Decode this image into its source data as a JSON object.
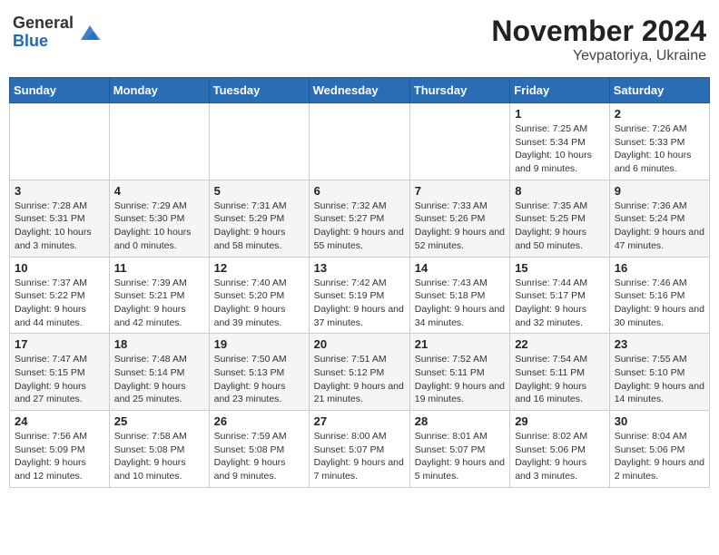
{
  "header": {
    "logo_general": "General",
    "logo_blue": "Blue",
    "title": "November 2024",
    "location": "Yevpatoriya, Ukraine"
  },
  "weekdays": [
    "Sunday",
    "Monday",
    "Tuesday",
    "Wednesday",
    "Thursday",
    "Friday",
    "Saturday"
  ],
  "weeks": [
    [
      {
        "day": "",
        "info": ""
      },
      {
        "day": "",
        "info": ""
      },
      {
        "day": "",
        "info": ""
      },
      {
        "day": "",
        "info": ""
      },
      {
        "day": "",
        "info": ""
      },
      {
        "day": "1",
        "info": "Sunrise: 7:25 AM\nSunset: 5:34 PM\nDaylight: 10 hours and 9 minutes."
      },
      {
        "day": "2",
        "info": "Sunrise: 7:26 AM\nSunset: 5:33 PM\nDaylight: 10 hours and 6 minutes."
      }
    ],
    [
      {
        "day": "3",
        "info": "Sunrise: 7:28 AM\nSunset: 5:31 PM\nDaylight: 10 hours and 3 minutes."
      },
      {
        "day": "4",
        "info": "Sunrise: 7:29 AM\nSunset: 5:30 PM\nDaylight: 10 hours and 0 minutes."
      },
      {
        "day": "5",
        "info": "Sunrise: 7:31 AM\nSunset: 5:29 PM\nDaylight: 9 hours and 58 minutes."
      },
      {
        "day": "6",
        "info": "Sunrise: 7:32 AM\nSunset: 5:27 PM\nDaylight: 9 hours and 55 minutes."
      },
      {
        "day": "7",
        "info": "Sunrise: 7:33 AM\nSunset: 5:26 PM\nDaylight: 9 hours and 52 minutes."
      },
      {
        "day": "8",
        "info": "Sunrise: 7:35 AM\nSunset: 5:25 PM\nDaylight: 9 hours and 50 minutes."
      },
      {
        "day": "9",
        "info": "Sunrise: 7:36 AM\nSunset: 5:24 PM\nDaylight: 9 hours and 47 minutes."
      }
    ],
    [
      {
        "day": "10",
        "info": "Sunrise: 7:37 AM\nSunset: 5:22 PM\nDaylight: 9 hours and 44 minutes."
      },
      {
        "day": "11",
        "info": "Sunrise: 7:39 AM\nSunset: 5:21 PM\nDaylight: 9 hours and 42 minutes."
      },
      {
        "day": "12",
        "info": "Sunrise: 7:40 AM\nSunset: 5:20 PM\nDaylight: 9 hours and 39 minutes."
      },
      {
        "day": "13",
        "info": "Sunrise: 7:42 AM\nSunset: 5:19 PM\nDaylight: 9 hours and 37 minutes."
      },
      {
        "day": "14",
        "info": "Sunrise: 7:43 AM\nSunset: 5:18 PM\nDaylight: 9 hours and 34 minutes."
      },
      {
        "day": "15",
        "info": "Sunrise: 7:44 AM\nSunset: 5:17 PM\nDaylight: 9 hours and 32 minutes."
      },
      {
        "day": "16",
        "info": "Sunrise: 7:46 AM\nSunset: 5:16 PM\nDaylight: 9 hours and 30 minutes."
      }
    ],
    [
      {
        "day": "17",
        "info": "Sunrise: 7:47 AM\nSunset: 5:15 PM\nDaylight: 9 hours and 27 minutes."
      },
      {
        "day": "18",
        "info": "Sunrise: 7:48 AM\nSunset: 5:14 PM\nDaylight: 9 hours and 25 minutes."
      },
      {
        "day": "19",
        "info": "Sunrise: 7:50 AM\nSunset: 5:13 PM\nDaylight: 9 hours and 23 minutes."
      },
      {
        "day": "20",
        "info": "Sunrise: 7:51 AM\nSunset: 5:12 PM\nDaylight: 9 hours and 21 minutes."
      },
      {
        "day": "21",
        "info": "Sunrise: 7:52 AM\nSunset: 5:11 PM\nDaylight: 9 hours and 19 minutes."
      },
      {
        "day": "22",
        "info": "Sunrise: 7:54 AM\nSunset: 5:11 PM\nDaylight: 9 hours and 16 minutes."
      },
      {
        "day": "23",
        "info": "Sunrise: 7:55 AM\nSunset: 5:10 PM\nDaylight: 9 hours and 14 minutes."
      }
    ],
    [
      {
        "day": "24",
        "info": "Sunrise: 7:56 AM\nSunset: 5:09 PM\nDaylight: 9 hours and 12 minutes."
      },
      {
        "day": "25",
        "info": "Sunrise: 7:58 AM\nSunset: 5:08 PM\nDaylight: 9 hours and 10 minutes."
      },
      {
        "day": "26",
        "info": "Sunrise: 7:59 AM\nSunset: 5:08 PM\nDaylight: 9 hours and 9 minutes."
      },
      {
        "day": "27",
        "info": "Sunrise: 8:00 AM\nSunset: 5:07 PM\nDaylight: 9 hours and 7 minutes."
      },
      {
        "day": "28",
        "info": "Sunrise: 8:01 AM\nSunset: 5:07 PM\nDaylight: 9 hours and 5 minutes."
      },
      {
        "day": "29",
        "info": "Sunrise: 8:02 AM\nSunset: 5:06 PM\nDaylight: 9 hours and 3 minutes."
      },
      {
        "day": "30",
        "info": "Sunrise: 8:04 AM\nSunset: 5:06 PM\nDaylight: 9 hours and 2 minutes."
      }
    ]
  ]
}
